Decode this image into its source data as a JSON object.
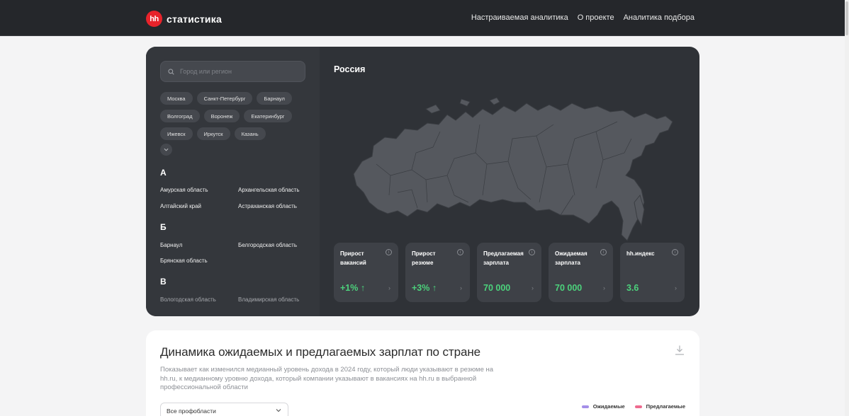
{
  "header": {
    "logo_mark": "hh",
    "logo_text": "статистика",
    "nav": [
      "Настраиваемая аналитика",
      "О проекте",
      "Аналитика подбора"
    ]
  },
  "sidebar": {
    "search_placeholder": "Город или регион",
    "cities": [
      [
        "Москва",
        "Санкт-Петербург",
        "Барнаул"
      ],
      [
        "Волгоград",
        "Воронеж",
        "Екатеринбург"
      ],
      [
        "Ижевск",
        "Иркутск",
        "Казань"
      ]
    ],
    "groups": [
      {
        "letter": "А",
        "regions": [
          "Амурская область",
          "Архангельская область",
          "Алтайский край",
          "Астраханская область"
        ]
      },
      {
        "letter": "Б",
        "regions": [
          "Барнаул",
          "Белгородская область",
          "Брянская область"
        ]
      },
      {
        "letter": "В",
        "regions": [
          "Вологодская область",
          "Владимирская область"
        ]
      }
    ]
  },
  "region": {
    "title": "Россия",
    "stats": [
      {
        "label": "Прирост вакансий",
        "value": "+1% ↑"
      },
      {
        "label": "Прирост резюме",
        "value": "+3% ↑"
      },
      {
        "label": "Предлагаемая зарплата",
        "value": "70 000"
      },
      {
        "label": "Ожидаемая зарплата",
        "value": "70 000"
      },
      {
        "label": "hh.индекс",
        "value": "3.6"
      }
    ]
  },
  "salary_dynamics": {
    "title": "Динамика ожидаемых и предлагаемых зарплат по стране",
    "description": "Показывает как изменился медианный уровень дохода в 2024 году, который люди указывают в резюме на hh.ru, к медианному уровню дохода, который компании указывают в вакансиях на hh.ru в выбранной профессиональной области",
    "filter_value": "Все профобласти",
    "legend": [
      {
        "label": "Ожидаемые",
        "color": "#a48ee8"
      },
      {
        "label": "Предлагаемые",
        "color": "#ee6b8f"
      }
    ]
  },
  "colors": {
    "accent_red": "#e8232b",
    "positive_green": "#4cd27c",
    "dark_bg": "#2f3237"
  }
}
